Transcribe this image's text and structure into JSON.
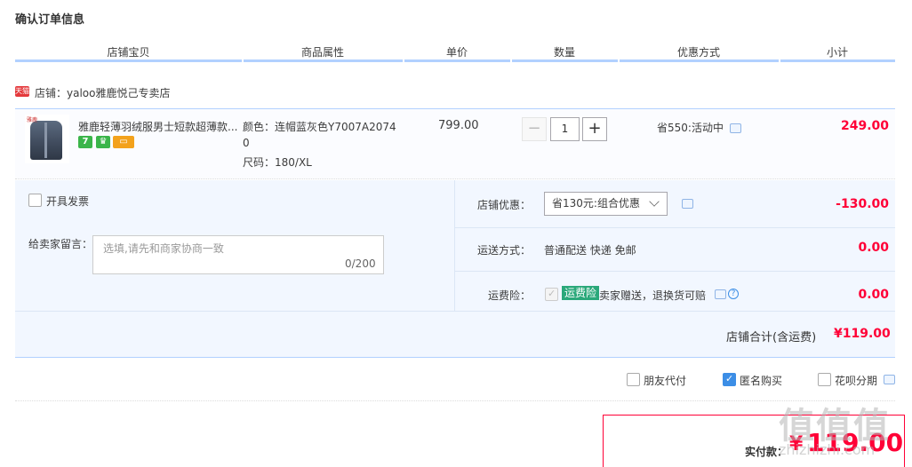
{
  "page": {
    "title": "确认订单信息"
  },
  "columns": [
    "店铺宝贝",
    "商品属性",
    "单价",
    "数量",
    "优惠方式",
    "小计"
  ],
  "shop": {
    "tag": "天猫",
    "name": "店铺：yaloo雅鹿悦己专卖店"
  },
  "item": {
    "thumb_logo": "雅鹿",
    "title": "雅鹿轻薄羽绒服男士短款超薄款...",
    "badges": [
      "7",
      "♛",
      "▭"
    ],
    "attr_color": "颜色：连帽蓝灰色Y7007A2074",
    "attr_color_wrap": "0",
    "attr_size": "尺码：180/XL",
    "unit_price": "799.00",
    "qty_minus": "−",
    "qty": "1",
    "qty_plus": "+",
    "discount": "省550:活动中",
    "subtotal": "249.00"
  },
  "invoice": {
    "label": "开具发票"
  },
  "memo": {
    "label": "给卖家留言：",
    "placeholder": "选填,请先和商家协商一致",
    "count": "0/200"
  },
  "shop_discount": {
    "label": "店铺优惠：",
    "selected": "省130元:组合优惠",
    "value": "-130.00"
  },
  "shipping": {
    "label": "运送方式：",
    "method": "普通配送 快递 免邮",
    "value": "0.00"
  },
  "insurance": {
    "label": "运费险：",
    "tag": "运费险",
    "desc": "卖家赠送，退换货可赔",
    "value": "0.00",
    "help": "?"
  },
  "shop_total": {
    "label": "店铺合计(含运费)",
    "value": "¥119.00"
  },
  "options": {
    "friend_pay": "朋友代付",
    "anonymous": "匿名购买",
    "huabei": "花呗分期"
  },
  "payment": {
    "label": "实付款：",
    "yen": "¥",
    "value": "119.00"
  },
  "watermark": {
    "main": "值值值",
    "sub": "zhizhizhi.com"
  }
}
